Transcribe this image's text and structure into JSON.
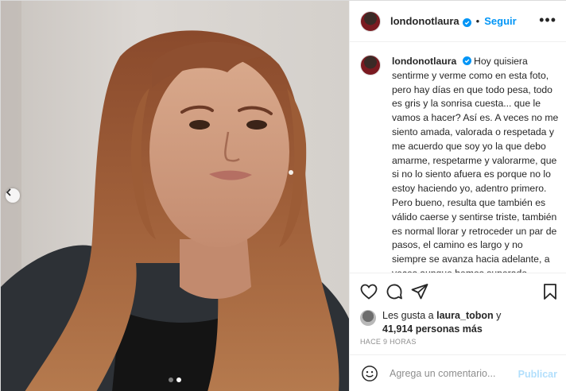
{
  "post": {
    "username": "londonotlaura",
    "separator": "•",
    "follow_label": "Seguir",
    "more_label": "•••",
    "caption_username": "londonotlaura",
    "caption_paragraphs": [
      "Hoy quisiera sentirme y verme como en esta foto, pero hay días en que todo pesa, todo es gris y la sonrisa cuesta... que le vamos a hacer? Así es. A veces no me siento amada, valorada o respetada y me acuerdo que soy yo la que debo amarme, respetarme y valorarme, que si no lo siento afuera es porque no lo estoy haciendo yo, adentro primero.",
      "Pero bueno, resulta que también es válido caerse y sentirse triste, también es normal llorar y retroceder un par de pasos, el camino es largo y no siempre se avanza hacia adelante, a veces aunque hemos superado muchas cosas, volvemos a caer en los mismos huecos y los aprendizajes vuelven a empezar, casi siempre a un nivel más profundo."
    ],
    "likes": {
      "prefix": "Les gusta a",
      "liker": "laura_tobon",
      "conjunction": "y",
      "others": "41,914 personas más"
    },
    "time_ago": "HACE 9 HORAS",
    "comment": {
      "placeholder": "Agrega un comentario...",
      "post_label": "Publicar"
    },
    "carousel": {
      "slide_count": 2,
      "active_slide": 2
    }
  },
  "icons": {
    "verified": "verified-badge-icon",
    "prev": "chevron-left-icon",
    "like": "heart-icon",
    "comment": "comment-bubble-icon",
    "share": "paper-plane-icon",
    "save": "bookmark-icon",
    "emoji": "smiley-icon",
    "more": "more-options-icon"
  },
  "colors": {
    "accent": "#0095f6",
    "post_disabled": "#b2dffc",
    "muted": "#8e8e8e",
    "text": "#262626"
  }
}
